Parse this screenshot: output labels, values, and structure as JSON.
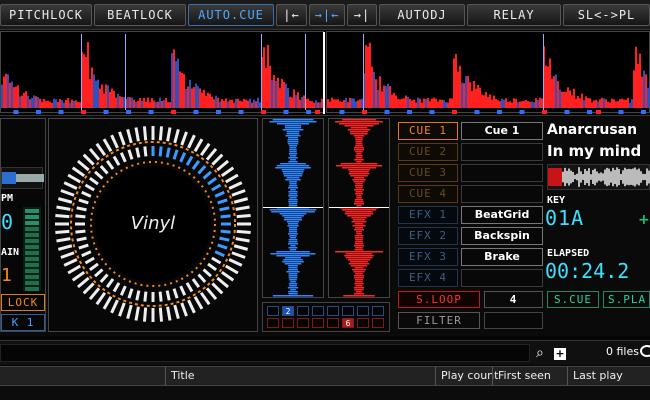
{
  "toolbar": {
    "buttons": [
      {
        "label": "PITCHLOCK"
      },
      {
        "label": "BEATLOCK"
      },
      {
        "label": "AUTO.CUE"
      },
      {
        "label": "|←"
      },
      {
        "label": "→|←"
      },
      {
        "label": "→|"
      },
      {
        "label": "AUTODJ"
      },
      {
        "label": "RELAY"
      },
      {
        "label": "SL<->PL"
      }
    ]
  },
  "left_deck": {
    "bpm_label": "PM",
    "gain_label": "AIN",
    "lock_label": "LOCK",
    "deck_label": "K 1"
  },
  "platter": {
    "label": "Vinyl"
  },
  "cues": [
    {
      "button": "CUE 1",
      "value": "Cue 1",
      "active": true
    },
    {
      "button": "CUE 2",
      "value": "",
      "active": false
    },
    {
      "button": "CUE 3",
      "value": "",
      "active": false
    },
    {
      "button": "CUE 4",
      "value": "",
      "active": false
    }
  ],
  "effects": [
    {
      "button": "EFX 1",
      "value": "BeatGrid"
    },
    {
      "button": "EFX 2",
      "value": "Backspin"
    },
    {
      "button": "EFX 3",
      "value": "Brake"
    },
    {
      "button": "EFX 4",
      "value": ""
    }
  ],
  "loop": {
    "button": "S.LOOP",
    "value": "4"
  },
  "filter": {
    "button": "FILTER"
  },
  "track": {
    "artist": "Anarcrusan",
    "title": "In my mind",
    "key_label": "KEY",
    "key_value": "01A",
    "elapsed_label": "ELAPSED",
    "elapsed_value": "00:24.2",
    "scue_label": "S.CUE",
    "splay_label": "S.PLA"
  },
  "sampler": {
    "left_number": "2",
    "right_number": "6"
  },
  "browser": {
    "files_count": "0 files",
    "columns": [
      "Title",
      "Play count",
      "First seen",
      "Last play"
    ]
  },
  "colors": {
    "orange": "#f08a20",
    "blue": "#3d9bff",
    "red": "#ff2020",
    "cyan": "#3ee0ff",
    "green": "#20c070"
  }
}
